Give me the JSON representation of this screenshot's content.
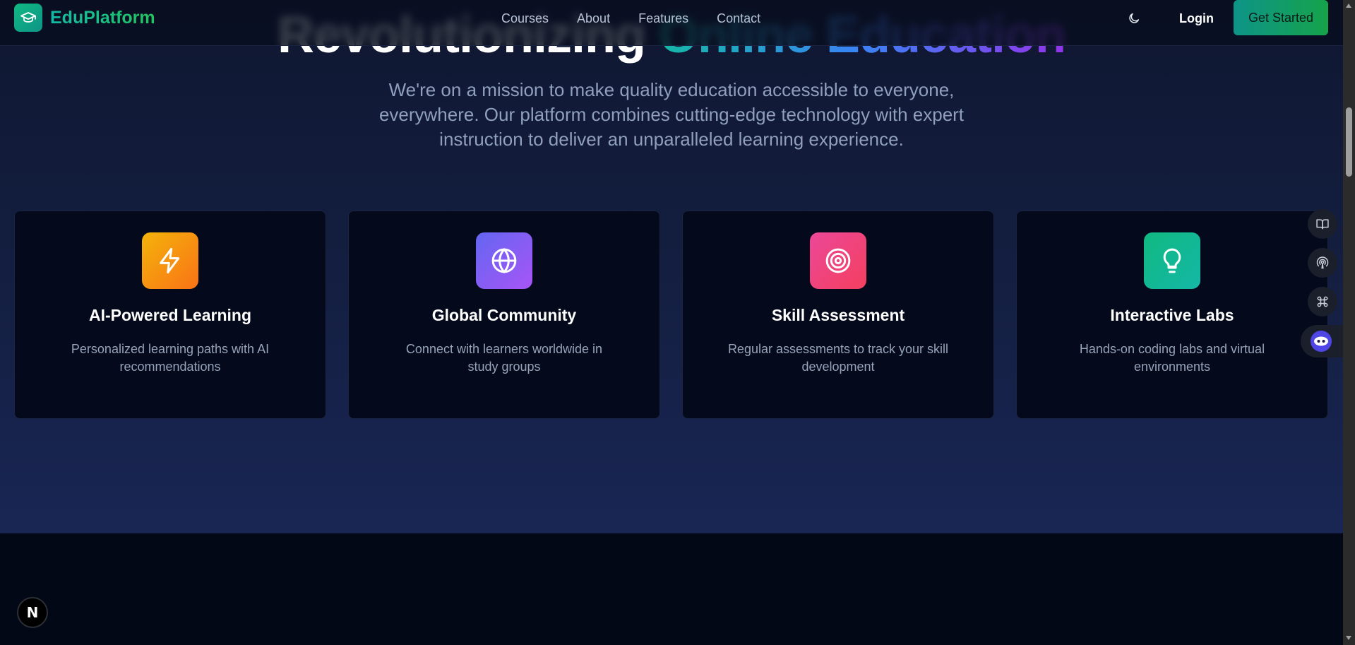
{
  "brand": {
    "name": "EduPlatform",
    "icon": "graduation-cap-icon"
  },
  "nav": {
    "links": [
      "Courses",
      "About",
      "Features",
      "Contact"
    ],
    "theme_icon": "moon-icon",
    "login_label": "Login",
    "cta_label": "Get Started"
  },
  "hero": {
    "title_plain": "Revolutionizing",
    "title_gradient": "Online Education",
    "subtitle": "We're on a mission to make quality education accessible to everyone, everywhere. Our platform combines cutting-edge technology with expert instruction to deliver an unparalleled learning experience."
  },
  "features": [
    {
      "title": "AI-Powered Learning",
      "description": "Personalized learning paths with AI recommendations",
      "icon": "lightning-icon",
      "color_from": "#f5b30b",
      "color_to": "#f97316"
    },
    {
      "title": "Global Community",
      "description": "Connect with learners worldwide in study groups",
      "icon": "globe-icon",
      "color_from": "#6366f1",
      "color_to": "#a855f7"
    },
    {
      "title": "Skill Assessment",
      "description": "Regular assessments to track your skill development",
      "icon": "target-icon",
      "color_from": "#ec4899",
      "color_to": "#f43f5e"
    },
    {
      "title": "Interactive Labs",
      "description": "Hands-on coding labs and virtual environments",
      "icon": "lightbulb-icon",
      "color_from": "#10b981",
      "color_to": "#14b8a6"
    }
  ],
  "floating_tools": [
    "book-icon",
    "broadcast-icon",
    "command-icon",
    "assistant-icon"
  ],
  "dev_badge": {
    "label": "N"
  },
  "colors": {
    "accent": "#14b8a6",
    "background": "#030817",
    "hero": "#141f42"
  }
}
